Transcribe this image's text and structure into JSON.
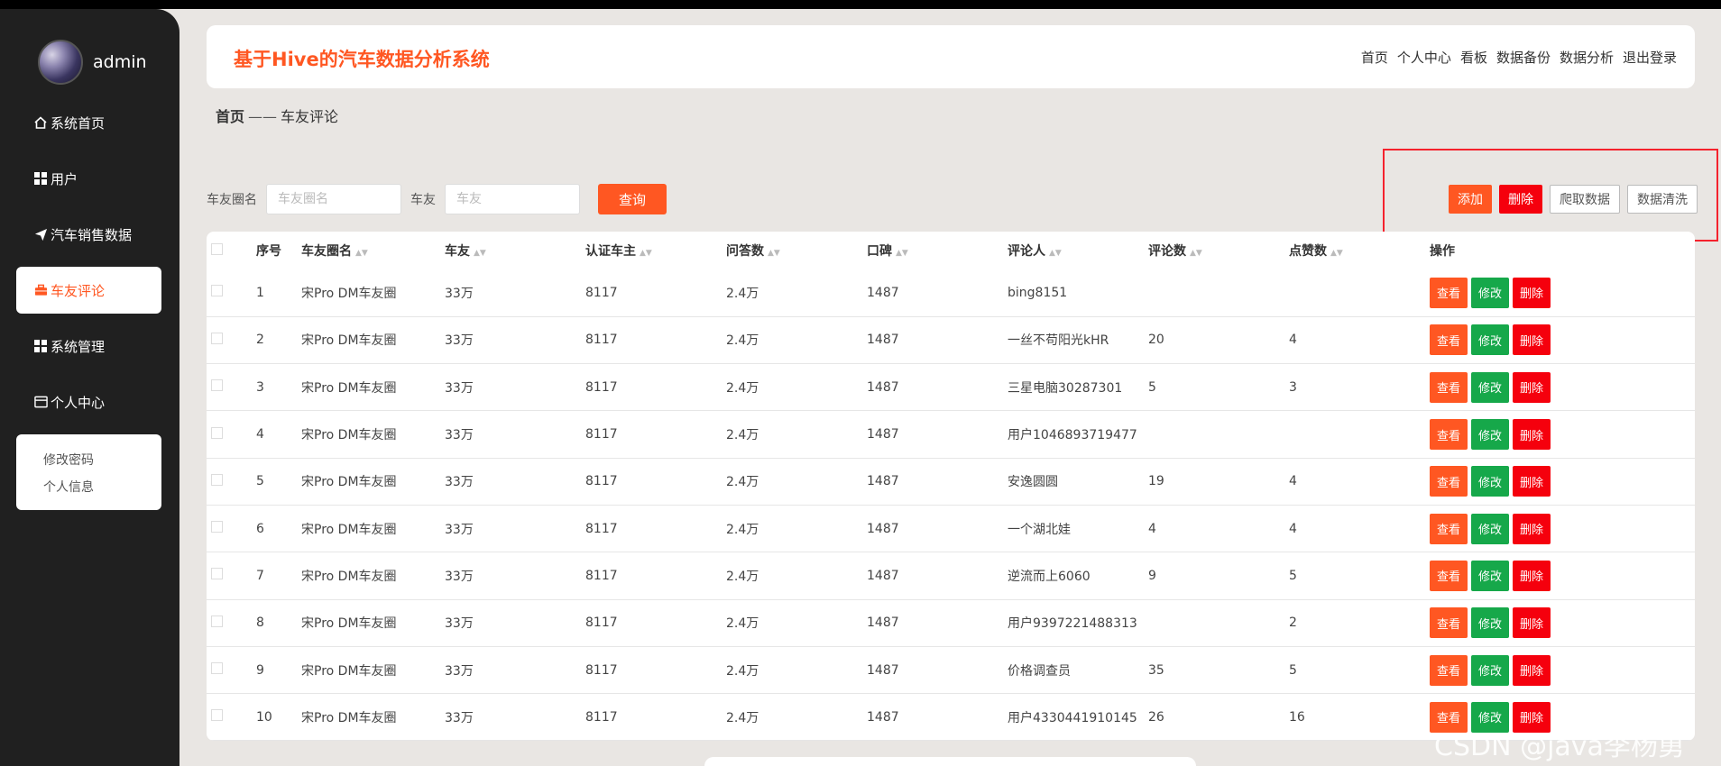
{
  "sidebar": {
    "username": "admin",
    "items": [
      {
        "label": "系统首页",
        "icon": "home-icon"
      },
      {
        "label": "用户",
        "icon": "grid-icon"
      },
      {
        "label": "汽车销售数据",
        "icon": "send-icon"
      },
      {
        "label": "车友评论",
        "icon": "briefcase-icon",
        "active": true
      },
      {
        "label": "系统管理",
        "icon": "grid-icon"
      },
      {
        "label": "个人中心",
        "icon": "window-icon"
      }
    ],
    "submenu": [
      "修改密码",
      "个人信息"
    ]
  },
  "header": {
    "title": "基于Hive的汽车数据分析系统",
    "links": [
      "首页",
      "个人中心",
      "看板",
      "数据备份",
      "数据分析",
      "退出登录"
    ]
  },
  "breadcrumb": {
    "home": "首页",
    "sep": "——",
    "current": "车友评论"
  },
  "search": {
    "field1_label": "车友圈名",
    "field1_placeholder": "车友圈名",
    "field2_label": "车友",
    "field2_placeholder": "车友",
    "button": "查询"
  },
  "actions": {
    "add": "添加",
    "delete": "删除",
    "crawl": "爬取数据",
    "clean": "数据清洗"
  },
  "table": {
    "columns": [
      "序号",
      "车友圈名",
      "车友",
      "认证车主",
      "问答数",
      "口碑",
      "评论人",
      "评论数",
      "点赞数",
      "操作"
    ],
    "row_buttons": {
      "view": "查看",
      "edit": "修改",
      "delete": "删除"
    },
    "rows": [
      {
        "no": "1",
        "circle": "宋Pro DM车友圈",
        "friends": "33万",
        "verified": "8117",
        "qa": "2.4万",
        "rep": "1487",
        "reviewer": "bing8151",
        "comments": "",
        "likes": ""
      },
      {
        "no": "2",
        "circle": "宋Pro DM车友圈",
        "friends": "33万",
        "verified": "8117",
        "qa": "2.4万",
        "rep": "1487",
        "reviewer": "一丝不苟阳光kHR",
        "comments": "20",
        "likes": "4"
      },
      {
        "no": "3",
        "circle": "宋Pro DM车友圈",
        "friends": "33万",
        "verified": "8117",
        "qa": "2.4万",
        "rep": "1487",
        "reviewer": "三星电脑30287301",
        "comments": "5",
        "likes": "3"
      },
      {
        "no": "4",
        "circle": "宋Pro DM车友圈",
        "friends": "33万",
        "verified": "8117",
        "qa": "2.4万",
        "rep": "1487",
        "reviewer": "用户1046893719477",
        "comments": "",
        "likes": ""
      },
      {
        "no": "5",
        "circle": "宋Pro DM车友圈",
        "friends": "33万",
        "verified": "8117",
        "qa": "2.4万",
        "rep": "1487",
        "reviewer": "安逸圆圆",
        "comments": "19",
        "likes": "4"
      },
      {
        "no": "6",
        "circle": "宋Pro DM车友圈",
        "friends": "33万",
        "verified": "8117",
        "qa": "2.4万",
        "rep": "1487",
        "reviewer": "一个湖北娃",
        "comments": "4",
        "likes": "4"
      },
      {
        "no": "7",
        "circle": "宋Pro DM车友圈",
        "friends": "33万",
        "verified": "8117",
        "qa": "2.4万",
        "rep": "1487",
        "reviewer": "逆流而上6060",
        "comments": "9",
        "likes": "5"
      },
      {
        "no": "8",
        "circle": "宋Pro DM车友圈",
        "friends": "33万",
        "verified": "8117",
        "qa": "2.4万",
        "rep": "1487",
        "reviewer": "用户9397221488313",
        "comments": "",
        "likes": "2"
      },
      {
        "no": "9",
        "circle": "宋Pro DM车友圈",
        "friends": "33万",
        "verified": "8117",
        "qa": "2.4万",
        "rep": "1487",
        "reviewer": "价格调查员",
        "comments": "35",
        "likes": "5"
      },
      {
        "no": "10",
        "circle": "宋Pro DM车友圈",
        "friends": "33万",
        "verified": "8117",
        "qa": "2.4万",
        "rep": "1487",
        "reviewer": "用户4330441910145",
        "comments": "26",
        "likes": "16"
      }
    ]
  },
  "watermark": "CSDN @java李杨勇"
}
